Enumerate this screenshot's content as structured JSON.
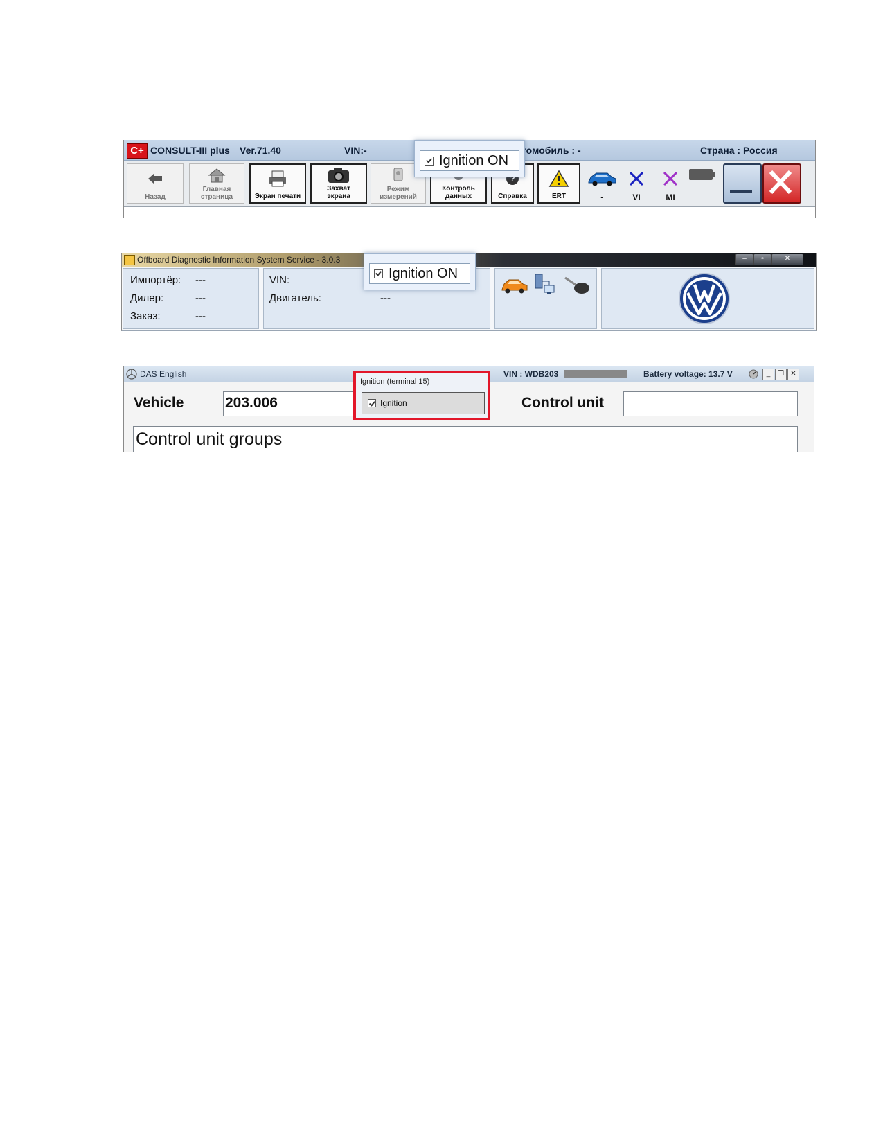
{
  "consult": {
    "app_name": "CONSULT-III plus",
    "version": "Ver.71.40",
    "vin": "VIN:-",
    "vehicle": "томобиль : -",
    "country": "Страна : Россия",
    "logo_text": "C+",
    "toolbar": {
      "back": "Назад",
      "home": "Главная страница",
      "print": "Экран печати",
      "capture": "Захват экрана",
      "measure": "Режим измерений",
      "data_control": "Контроль данных",
      "help": "Справка",
      "ert": "ERT",
      "car_status": "-",
      "vi": "VI",
      "mi": "MI"
    },
    "popup": {
      "label": "Ignition ON",
      "checked": true
    }
  },
  "odis": {
    "title": "Offboard Diagnostic Information System Service - 3.0.3",
    "labels": {
      "importer": "Импортёр:",
      "importer_val": "---",
      "dealer": "Дилер:",
      "dealer_val": "---",
      "order": "Заказ:",
      "order_val": "---",
      "vin": "VIN:",
      "engine": "Двигатель:",
      "engine_val": "---"
    },
    "popup": {
      "label": "Ignition ON",
      "checked": true
    },
    "colors": {
      "vw_blue": "#1c3f8c"
    }
  },
  "das": {
    "title": "DAS English",
    "vin": "VIN : WDB203",
    "battery": "Battery voltage: 13.7 V",
    "vehicle_label": "Vehicle",
    "vehicle_value": "203.006",
    "control_unit_label": "Control unit",
    "control_unit_value": "",
    "groups_label": "Control unit groups",
    "popup": {
      "title": "Ignition (terminal 15)",
      "label": "Ignition",
      "checked": true
    },
    "colors": {
      "highlight": "#e2162a"
    }
  }
}
